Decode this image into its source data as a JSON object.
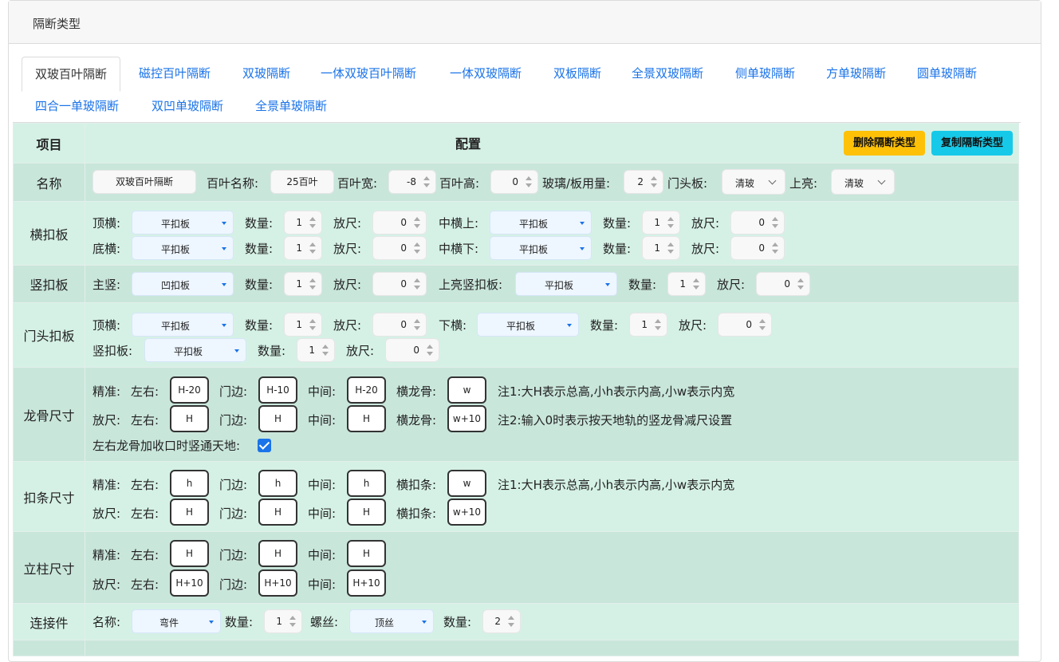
{
  "header": {
    "title": "隔断类型"
  },
  "tabs": [
    "双玻百叶隔断",
    "磁控百叶隔断",
    "双玻隔断",
    "一体双玻百叶隔断",
    "一体双玻隔断",
    "双板隔断",
    "全景双玻隔断",
    "侧单玻隔断",
    "方单玻隔断",
    "圆单玻隔断",
    "四合一单玻隔断",
    "双凹单玻隔断",
    "全景单玻隔断"
  ],
  "active_tab": "双玻百叶隔断",
  "table": {
    "col_item": "项目",
    "col_config": "配置",
    "delete_button": "删除隔断类型",
    "copy_button": "复制隔断类型"
  },
  "name_row": {
    "label": "名称",
    "name_value": "双玻百叶隔断",
    "blind_name_label": "百叶名称:",
    "blind_name_value": "25百叶",
    "blind_width_label": "百叶宽:",
    "blind_width_value": "-8",
    "blind_height_label": "百叶高:",
    "blind_height_value": "0",
    "glass_label": "玻璃/板用量:",
    "glass_value": "2",
    "door_head_label": "门头板:",
    "door_head_value": "清玻",
    "top_light_label": "上亮:",
    "top_light_value": "清玻"
  },
  "hbuckle": {
    "label": "横扣板",
    "top_label": "顶横:",
    "top_value": "平扣板",
    "top_qty_label": "数量:",
    "top_qty": "1",
    "top_allow_label": "放尺:",
    "top_allow": "0",
    "mid_up_label": "中横上:",
    "mid_up_value": "平扣板",
    "mid_up_qty_label": "数量:",
    "mid_up_qty": "1",
    "mid_up_allow_label": "放尺:",
    "mid_up_allow": "0",
    "bottom_label": "底横:",
    "bottom_value": "平扣板",
    "bottom_qty_label": "数量:",
    "bottom_qty": "1",
    "bottom_allow_label": "放尺:",
    "bottom_allow": "0",
    "mid_down_label": "中横下:",
    "mid_down_value": "平扣板",
    "mid_down_qty_label": "数量:",
    "mid_down_qty": "1",
    "mid_down_allow_label": "放尺:",
    "mid_down_allow": "0"
  },
  "vbuckle": {
    "label": "竖扣板",
    "main_label": "主竖:",
    "main_value": "凹扣板",
    "main_qty_label": "数量:",
    "main_qty": "1",
    "main_allow_label": "放尺:",
    "main_allow": "0",
    "top_light_label": "上亮竖扣板:",
    "top_light_value": "平扣板",
    "top_light_qty_label": "数量:",
    "top_light_qty": "1",
    "top_light_allow_label": "放尺:",
    "top_light_allow": "0"
  },
  "doorhead": {
    "label": "门头扣板",
    "top_label": "顶横:",
    "top_value": "平扣板",
    "top_qty_label": "数量:",
    "top_qty": "1",
    "top_allow_label": "放尺:",
    "top_allow": "0",
    "bottom_label": "下横:",
    "bottom_value": "平扣板",
    "bottom_qty_label": "数量:",
    "bottom_qty": "1",
    "bottom_allow_label": "放尺:",
    "bottom_allow": "0",
    "vert_label": "竖扣板:",
    "vert_value": "平扣板",
    "vert_qty_label": "数量:",
    "vert_qty": "1",
    "vert_allow_label": "放尺:",
    "vert_allow": "0"
  },
  "keel": {
    "label": "龙骨尺寸",
    "precise_label": "精准:",
    "allow_label": "放尺:",
    "lr_label": "左右:",
    "door_label": "门边:",
    "mid_label": "中间:",
    "hkeel_label": "横龙骨:",
    "precise_lr": "H-20",
    "precise_door": "H-10",
    "precise_mid": "H-20",
    "precise_h": "w",
    "allow_lr": "H",
    "allow_door": "H",
    "allow_mid": "H",
    "allow_h": "w+10",
    "note1": "注1:大H表示总高,小h表示内高,小w表示内宽",
    "note2": "注2:输入0时表示按天地轨的竖龙骨减尺设置",
    "checkbox_label": "左右龙骨加收口时竖通天地:",
    "checkbox_checked": true
  },
  "strip": {
    "label": "扣条尺寸",
    "precise_label": "精准:",
    "allow_label": "放尺:",
    "lr_label": "左右:",
    "door_label": "门边:",
    "mid_label": "中间:",
    "hstrip_label": "横扣条:",
    "precise_lr": "h",
    "precise_door": "h",
    "precise_mid": "h",
    "precise_h": "w",
    "allow_lr": "H",
    "allow_door": "H",
    "allow_mid": "H",
    "allow_h": "w+10",
    "note1": "注1:大H表示总高,小h表示内高,小w表示内宽"
  },
  "post": {
    "label": "立柱尺寸",
    "precise_label": "精准:",
    "allow_label": "放尺:",
    "lr_label": "左右:",
    "door_label": "门边:",
    "mid_label": "中间:",
    "precise_lr": "H",
    "precise_door": "H",
    "precise_mid": "H",
    "allow_lr": "H+10",
    "allow_door": "H+10",
    "allow_mid": "H+10"
  },
  "connector": {
    "label": "连接件",
    "name_label": "名称:",
    "name_value": "弯件",
    "qty_label": "数量:",
    "qty": "1",
    "screw_label": "螺丝:",
    "screw_value": "顶丝",
    "screw_qty_label": "数量:",
    "screw_qty": "2"
  },
  "colors": {
    "tab_link": "#1a73e8",
    "row_dark": "#c9e6db",
    "row_light": "#d5f1e6",
    "delete_button": "#ffc107",
    "copy_button": "#17c9e8"
  }
}
